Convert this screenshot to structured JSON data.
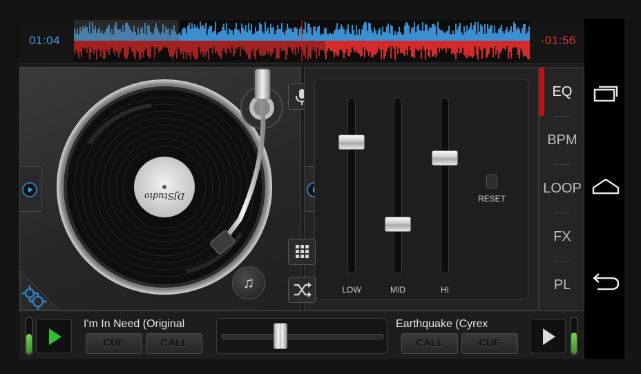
{
  "waveform": {
    "time_elapsed": "01:04",
    "time_remaining": "-01:56",
    "colors": {
      "deck_a": "#3a8fd0",
      "deck_b": "#d42a2a",
      "playhead": "#ff2020"
    },
    "progress_a": 0.23,
    "progress_b": 0.55
  },
  "deck_left": {
    "record_label": "DJStudio",
    "icons": [
      "settings-gears-icon",
      "add-music-icon",
      "play-small-icon"
    ]
  },
  "center_tools": {
    "icons": [
      "microphone-icon",
      "grid-icon",
      "shuffle-icon"
    ]
  },
  "eq": {
    "sliders": [
      {
        "label": "LOW",
        "level": 0.77
      },
      {
        "label": "MID",
        "level": 0.26
      },
      {
        "label": "HI",
        "level": 0.67
      }
    ],
    "reset_label": "RESET"
  },
  "tabs": {
    "items": [
      "EQ",
      "BPM",
      "LOOP",
      "FX",
      "PL"
    ],
    "active": "EQ",
    "accent": "#c41010"
  },
  "transport": {
    "left": {
      "title": "I'm In Need (Original",
      "cue_label": "CUE",
      "call_label": "CALL",
      "level": 0.55
    },
    "right": {
      "title": "Earthquake (Cyrex",
      "call_label": "CALL",
      "cue_label": "CUE",
      "level": 0.6
    },
    "crossfader_position": 0.35,
    "play_color": "#2fbe2f"
  },
  "system_nav": {
    "icons": [
      "recent-apps-icon",
      "home-icon",
      "back-icon"
    ]
  }
}
